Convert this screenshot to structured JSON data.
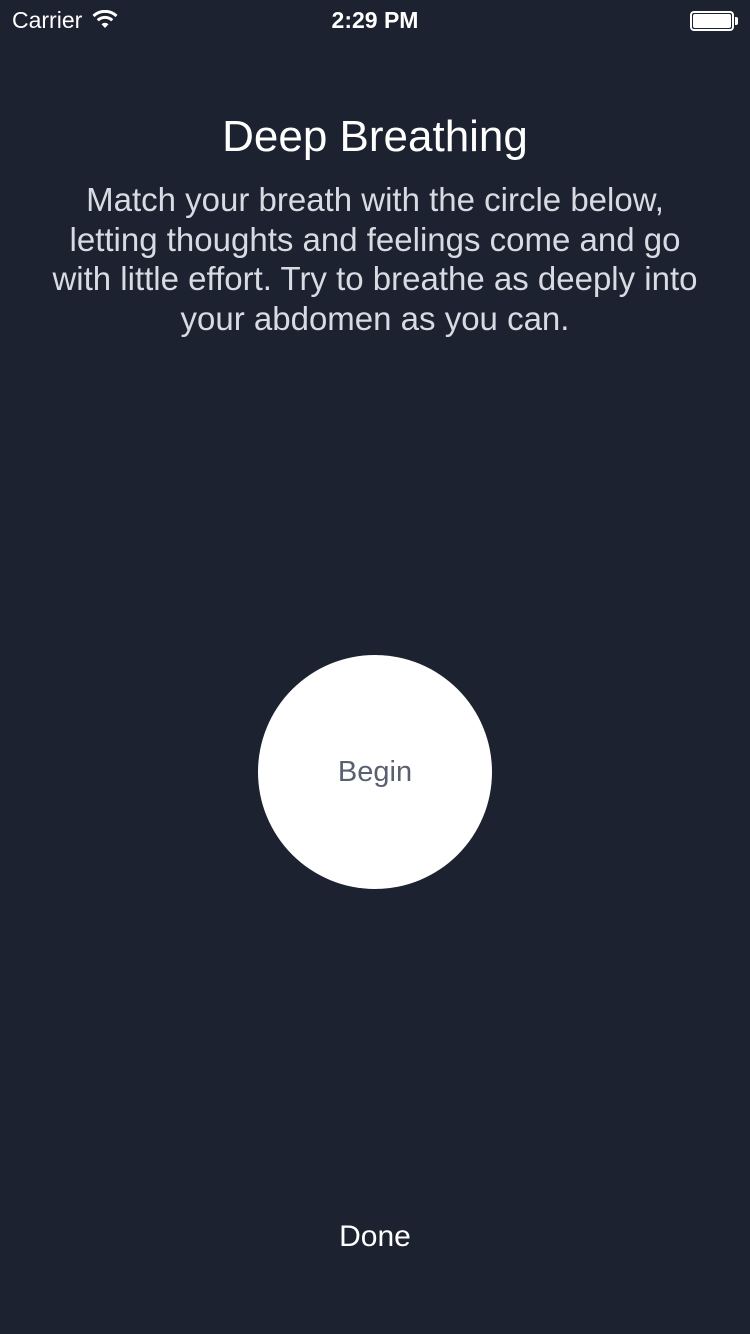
{
  "status_bar": {
    "carrier": "Carrier",
    "time": "2:29 PM",
    "wifi_icon": "wifi-icon",
    "battery_icon": "battery-icon",
    "battery_level": 1.0
  },
  "screen": {
    "title": "Deep Breathing",
    "instructions": "Match your breath with the circle below, letting thoughts and feelings come and go with little effort. Try to breathe as deeply into your abdomen as you can.",
    "circle_label": "Begin",
    "done_label": "Done"
  },
  "colors": {
    "background": "#1c2230",
    "circle": "#ffffff",
    "circle_text": "#5a6070",
    "body_text": "#d8dbe2"
  }
}
